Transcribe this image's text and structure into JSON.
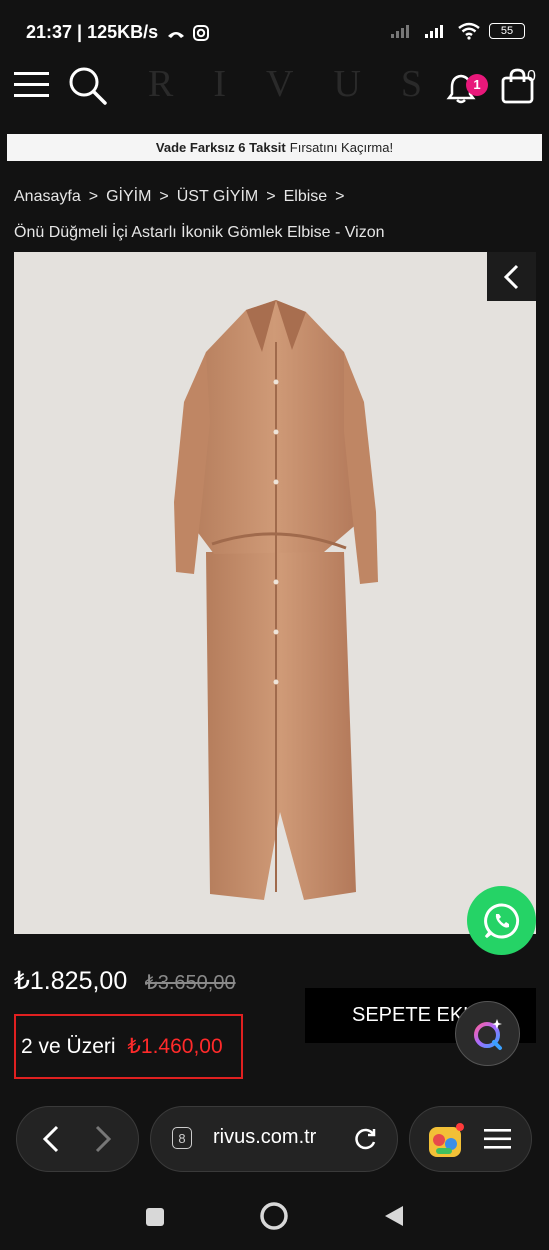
{
  "status": {
    "time": "21:37 | 125KB/s",
    "battery": "55"
  },
  "header": {
    "logo": "RIVUS",
    "notification_count": "1",
    "cart_count": "0"
  },
  "promo": {
    "bold": "Vade Farksız 6 Taksit",
    "rest": "Fırsatını Kaçırma!"
  },
  "breadcrumb": {
    "items": [
      "Anasayfa",
      "GİYİM",
      "ÜST GİYİM",
      "Elbise"
    ],
    "separator": ">"
  },
  "product": {
    "title": "Önü Düğmeli İçi Astarlı İkonik Gömlek Elbise - Vizon",
    "price": "₺1.825,00",
    "old_price": "₺3.650,00",
    "bulk_label": "2 ve Üzeri",
    "bulk_price": "₺1.460,00",
    "add_to_cart": "SEPETE EKLE"
  },
  "browser": {
    "url": "rivus.com.tr",
    "tab_count": "8"
  },
  "colors": {
    "badge": "#e8187a",
    "whatsapp": "#25d366",
    "bulk_border": "#e02020",
    "dress": "#c8906c"
  }
}
